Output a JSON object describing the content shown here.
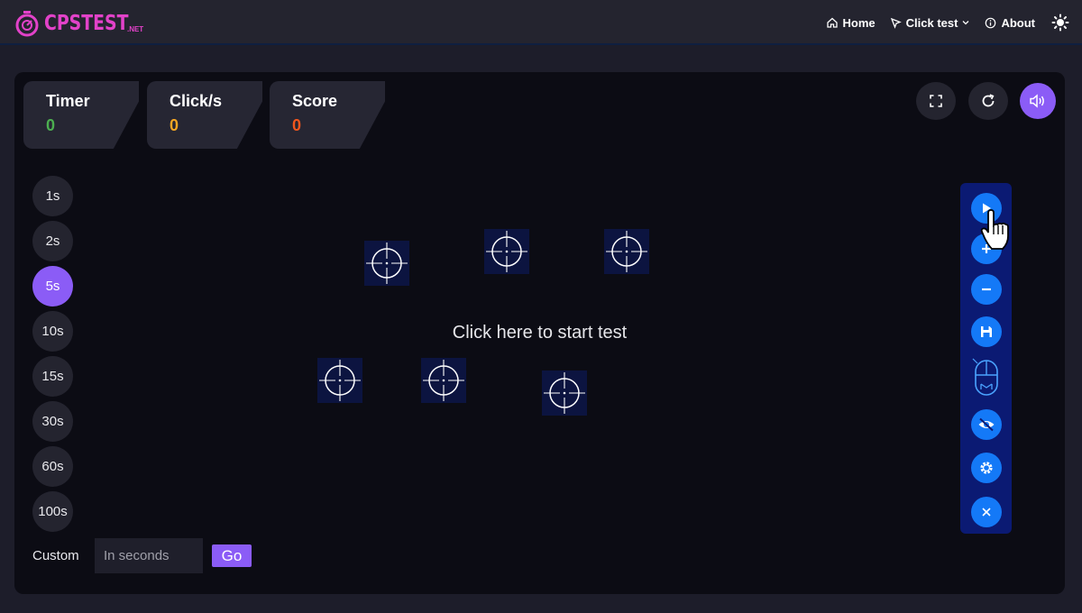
{
  "brand": {
    "name": "CPSTEST",
    "suffix": ".NET"
  },
  "nav": {
    "home": "Home",
    "click_test": "Click test",
    "about": "About"
  },
  "stats": {
    "timer": {
      "label": "Timer",
      "value": "0",
      "color": "#4caf50"
    },
    "cps": {
      "label": "Click/s",
      "value": "0",
      "color": "#f5a623"
    },
    "score": {
      "label": "Score",
      "value": "0",
      "color": "#f2561d"
    }
  },
  "durations": [
    "1s",
    "2s",
    "5s",
    "10s",
    "15s",
    "30s",
    "60s",
    "100s"
  ],
  "active_duration": "5s",
  "custom": {
    "label": "Custom",
    "placeholder": "In seconds",
    "go": "Go"
  },
  "start_text": "Click here to start test",
  "colors": {
    "accent": "#8b5cf6",
    "tool_blue": "#1479f7",
    "sidebar": "#0b1a73",
    "brand": "#e242c9"
  },
  "tools": [
    "play-icon",
    "plus-icon",
    "minus-icon",
    "save-icon",
    "mouse-icon",
    "hide-eye-icon",
    "settings-gear-icon",
    "close-icon"
  ]
}
